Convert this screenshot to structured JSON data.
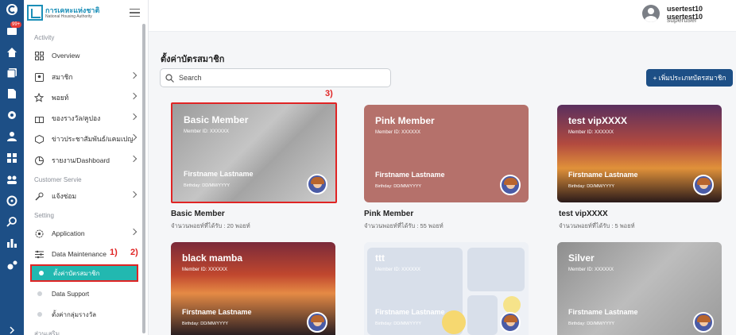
{
  "sidebar": {
    "logo_th": "การเคหะแห่งชาติ",
    "logo_en": "National Housing Authority",
    "badge": "99+",
    "section_activity": "Activity",
    "section_customer": "Customer Servie",
    "section_setting": "Setting",
    "section_more": "ส่วนเสริม",
    "items": [
      {
        "label": "Overview",
        "icon": "grid-icon"
      },
      {
        "label": "สมาชิก",
        "icon": "member-icon"
      },
      {
        "label": "พอยท์",
        "icon": "star-icon"
      },
      {
        "label": "ของรางวัล/คูปอง",
        "icon": "gift-icon"
      },
      {
        "label": "ข่าวประชาสัมพันธ์/แคมเปญ",
        "icon": "box-icon"
      },
      {
        "label": "รายงาน/Dashboard",
        "icon": "chart-icon"
      },
      {
        "label": "แจ้งซ่อม",
        "icon": "wrench-icon"
      },
      {
        "label": "Application",
        "icon": "gear-icon"
      },
      {
        "label": "Data Maintenance",
        "icon": "sliders-icon"
      }
    ],
    "sub_items": [
      {
        "label": "ตั้งค่าบัตรสมาชิก"
      },
      {
        "label": "Data Support"
      },
      {
        "label": "ตั้งค่ากลุ่มรางวัล"
      }
    ]
  },
  "annotations": {
    "a1": "1)",
    "a2": "2)",
    "a3": "3)"
  },
  "header": {
    "user_name": "usertest10 usertest10",
    "user_role": "superuser"
  },
  "main": {
    "title": "ตั้งค่าบัตรสมาชิก",
    "search_placeholder": "Search",
    "add_button": "+ เพิ่มประเภทบัตรสมาชิก",
    "card_name": "Firstname Lastname",
    "card_id": "Member ID: XXXXXX",
    "card_bday": "Birthday: DD/MM/YYYY",
    "cards": [
      {
        "title": "Basic Member",
        "sub": "จำนวนพอยท์ที่ได้รับ : 20 พอยท์",
        "color": "#a9a9a9"
      },
      {
        "title": "Pink Member",
        "sub": "จำนวนพอยท์ที่ได้รับ : 55 พอยท์",
        "color": "#b5716b"
      },
      {
        "title": "test vipXXXX",
        "sub": "จำนวนพอยท์ที่ได้รับ : 5 พอยท์",
        "color": "#6b2f55"
      },
      {
        "title": "black mamba",
        "sub": "",
        "color": "#9a3a2a"
      },
      {
        "title": "ttt",
        "sub": "",
        "color": "#dce3ee"
      },
      {
        "title": "Silver",
        "sub": "",
        "color": "#9c9c9c"
      }
    ]
  }
}
